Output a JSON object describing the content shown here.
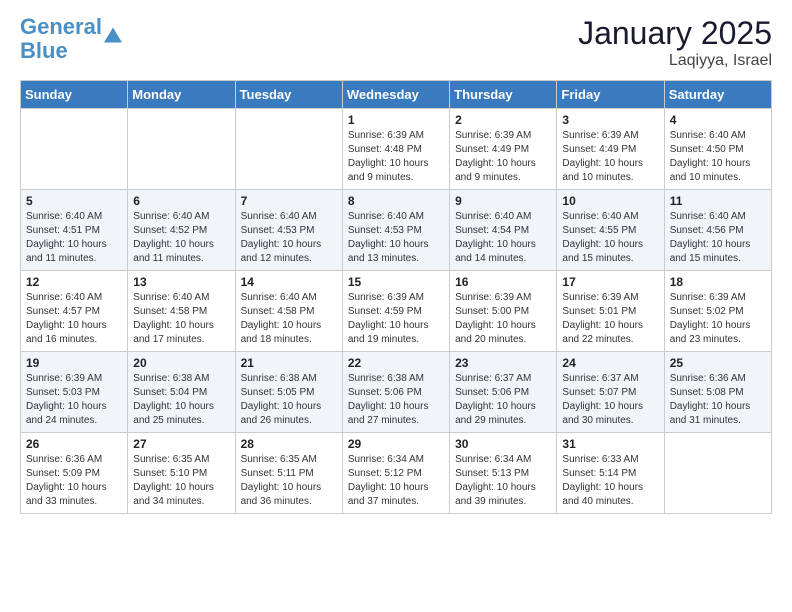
{
  "header": {
    "logo_line1": "General",
    "logo_line2": "Blue",
    "month": "January 2025",
    "location": "Laqiyya, Israel"
  },
  "weekdays": [
    "Sunday",
    "Monday",
    "Tuesday",
    "Wednesday",
    "Thursday",
    "Friday",
    "Saturday"
  ],
  "weeks": [
    [
      {
        "day": "",
        "text": ""
      },
      {
        "day": "",
        "text": ""
      },
      {
        "day": "",
        "text": ""
      },
      {
        "day": "1",
        "text": "Sunrise: 6:39 AM\nSunset: 4:48 PM\nDaylight: 10 hours\nand 9 minutes."
      },
      {
        "day": "2",
        "text": "Sunrise: 6:39 AM\nSunset: 4:49 PM\nDaylight: 10 hours\nand 9 minutes."
      },
      {
        "day": "3",
        "text": "Sunrise: 6:39 AM\nSunset: 4:49 PM\nDaylight: 10 hours\nand 10 minutes."
      },
      {
        "day": "4",
        "text": "Sunrise: 6:40 AM\nSunset: 4:50 PM\nDaylight: 10 hours\nand 10 minutes."
      }
    ],
    [
      {
        "day": "5",
        "text": "Sunrise: 6:40 AM\nSunset: 4:51 PM\nDaylight: 10 hours\nand 11 minutes."
      },
      {
        "day": "6",
        "text": "Sunrise: 6:40 AM\nSunset: 4:52 PM\nDaylight: 10 hours\nand 11 minutes."
      },
      {
        "day": "7",
        "text": "Sunrise: 6:40 AM\nSunset: 4:53 PM\nDaylight: 10 hours\nand 12 minutes."
      },
      {
        "day": "8",
        "text": "Sunrise: 6:40 AM\nSunset: 4:53 PM\nDaylight: 10 hours\nand 13 minutes."
      },
      {
        "day": "9",
        "text": "Sunrise: 6:40 AM\nSunset: 4:54 PM\nDaylight: 10 hours\nand 14 minutes."
      },
      {
        "day": "10",
        "text": "Sunrise: 6:40 AM\nSunset: 4:55 PM\nDaylight: 10 hours\nand 15 minutes."
      },
      {
        "day": "11",
        "text": "Sunrise: 6:40 AM\nSunset: 4:56 PM\nDaylight: 10 hours\nand 15 minutes."
      }
    ],
    [
      {
        "day": "12",
        "text": "Sunrise: 6:40 AM\nSunset: 4:57 PM\nDaylight: 10 hours\nand 16 minutes."
      },
      {
        "day": "13",
        "text": "Sunrise: 6:40 AM\nSunset: 4:58 PM\nDaylight: 10 hours\nand 17 minutes."
      },
      {
        "day": "14",
        "text": "Sunrise: 6:40 AM\nSunset: 4:58 PM\nDaylight: 10 hours\nand 18 minutes."
      },
      {
        "day": "15",
        "text": "Sunrise: 6:39 AM\nSunset: 4:59 PM\nDaylight: 10 hours\nand 19 minutes."
      },
      {
        "day": "16",
        "text": "Sunrise: 6:39 AM\nSunset: 5:00 PM\nDaylight: 10 hours\nand 20 minutes."
      },
      {
        "day": "17",
        "text": "Sunrise: 6:39 AM\nSunset: 5:01 PM\nDaylight: 10 hours\nand 22 minutes."
      },
      {
        "day": "18",
        "text": "Sunrise: 6:39 AM\nSunset: 5:02 PM\nDaylight: 10 hours\nand 23 minutes."
      }
    ],
    [
      {
        "day": "19",
        "text": "Sunrise: 6:39 AM\nSunset: 5:03 PM\nDaylight: 10 hours\nand 24 minutes."
      },
      {
        "day": "20",
        "text": "Sunrise: 6:38 AM\nSunset: 5:04 PM\nDaylight: 10 hours\nand 25 minutes."
      },
      {
        "day": "21",
        "text": "Sunrise: 6:38 AM\nSunset: 5:05 PM\nDaylight: 10 hours\nand 26 minutes."
      },
      {
        "day": "22",
        "text": "Sunrise: 6:38 AM\nSunset: 5:06 PM\nDaylight: 10 hours\nand 27 minutes."
      },
      {
        "day": "23",
        "text": "Sunrise: 6:37 AM\nSunset: 5:06 PM\nDaylight: 10 hours\nand 29 minutes."
      },
      {
        "day": "24",
        "text": "Sunrise: 6:37 AM\nSunset: 5:07 PM\nDaylight: 10 hours\nand 30 minutes."
      },
      {
        "day": "25",
        "text": "Sunrise: 6:36 AM\nSunset: 5:08 PM\nDaylight: 10 hours\nand 31 minutes."
      }
    ],
    [
      {
        "day": "26",
        "text": "Sunrise: 6:36 AM\nSunset: 5:09 PM\nDaylight: 10 hours\nand 33 minutes."
      },
      {
        "day": "27",
        "text": "Sunrise: 6:35 AM\nSunset: 5:10 PM\nDaylight: 10 hours\nand 34 minutes."
      },
      {
        "day": "28",
        "text": "Sunrise: 6:35 AM\nSunset: 5:11 PM\nDaylight: 10 hours\nand 36 minutes."
      },
      {
        "day": "29",
        "text": "Sunrise: 6:34 AM\nSunset: 5:12 PM\nDaylight: 10 hours\nand 37 minutes."
      },
      {
        "day": "30",
        "text": "Sunrise: 6:34 AM\nSunset: 5:13 PM\nDaylight: 10 hours\nand 39 minutes."
      },
      {
        "day": "31",
        "text": "Sunrise: 6:33 AM\nSunset: 5:14 PM\nDaylight: 10 hours\nand 40 minutes."
      },
      {
        "day": "",
        "text": ""
      }
    ]
  ]
}
